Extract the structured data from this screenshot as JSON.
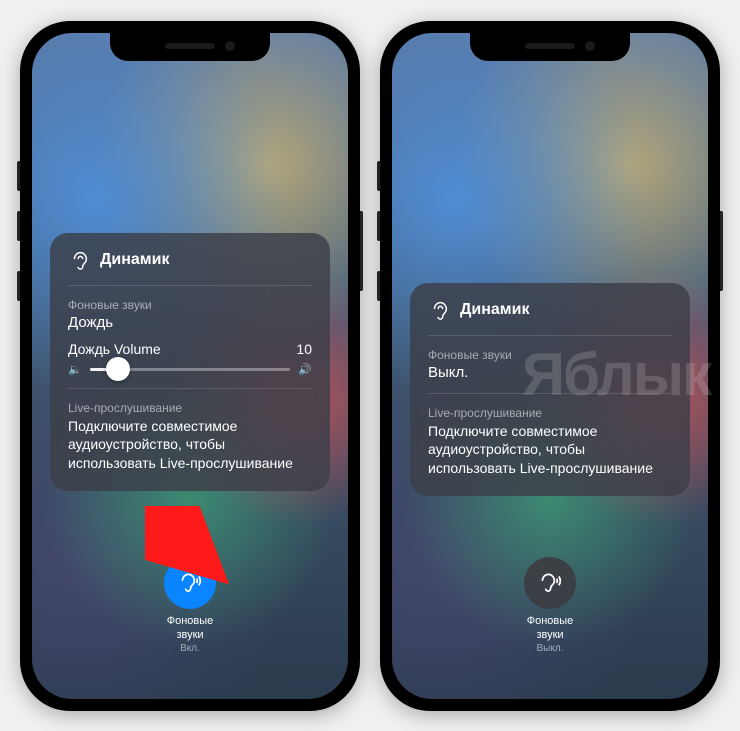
{
  "watermark": "Яблык",
  "left": {
    "card": {
      "title": "Динамик",
      "bg_label": "Фоновые звуки",
      "bg_value": "Дождь",
      "volume_label": "Дождь Volume",
      "volume_value": "10",
      "volume_percent": 14,
      "live_label": "Live-прослушивание",
      "live_text": "Подключите совместимое аудиоустройство, чтобы использовать Live-прослушивание"
    },
    "button": {
      "label": "Фоновые\nзвуки",
      "state": "Вкл.",
      "active": true
    }
  },
  "right": {
    "card": {
      "title": "Динамик",
      "bg_label": "Фоновые звуки",
      "bg_value": "Выкл.",
      "live_label": "Live-прослушивание",
      "live_text": "Подключите совместимое аудиоустройство, чтобы использовать Live-прослушивание"
    },
    "button": {
      "label": "Фоновые\nзвуки",
      "state": "Выкл.",
      "active": false
    }
  }
}
